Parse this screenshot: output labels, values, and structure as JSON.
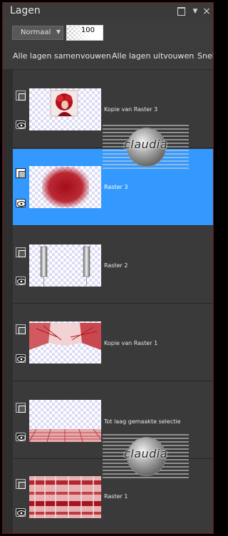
{
  "panel": {
    "title": "Lagen"
  },
  "titlebar": {
    "restore_icon": "restore-icon",
    "menu_icon": "dropdown-arrow-icon",
    "close_label": "×"
  },
  "toolbar": {
    "blend_mode": "Normaal",
    "blend_arrow": "▼",
    "opacity": "100"
  },
  "actions": {
    "collapse_all": "Alle lagen samenvouwen",
    "expand_all": "Alle lagen uitvouwen",
    "quick": "Snel"
  },
  "layers": [
    {
      "name": "Kopie van Raster 3",
      "selected": false,
      "thumbnail": "portrait-red-hair"
    },
    {
      "name": "Raster 3",
      "selected": true,
      "thumbnail": "red-block"
    },
    {
      "name": "Raster 2",
      "selected": false,
      "thumbnail": "two-silver-bars"
    },
    {
      "name": "Kopie van Raster 1",
      "selected": false,
      "thumbnail": "red-perspective"
    },
    {
      "name": "Tot laag gemaakte selectie",
      "selected": false,
      "thumbnail": "red-floor-strip"
    },
    {
      "name": "Raster 1",
      "selected": false,
      "thumbnail": "red-streaks"
    }
  ],
  "watermarks": [
    {
      "text": "claudia"
    },
    {
      "text": "claudia"
    }
  ],
  "colors": {
    "selected_row": "#3399ff",
    "panel_bg": "#3c3c3c",
    "frame_border": "#7a0f12",
    "accent_red": "#b0101c"
  }
}
